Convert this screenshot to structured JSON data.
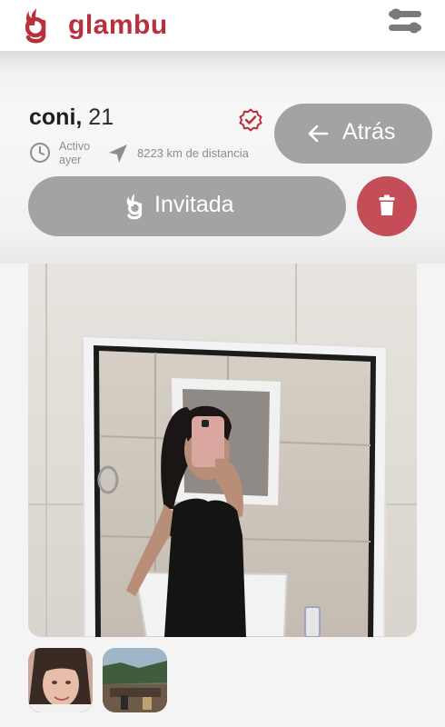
{
  "app": {
    "logo_text": "glambu",
    "brand_color": "#b9303d"
  },
  "profile": {
    "name": "coni,",
    "age": "21",
    "activity_line1": "Activo",
    "activity_line2": "ayer",
    "distance": "8223  km de distancia",
    "verified_icon": "verified-badge-icon"
  },
  "actions": {
    "back_label": "Atrás",
    "invite_label": "Invitada",
    "delete_icon": "trash-icon",
    "button_color": "#a3a3a3",
    "delete_color": "#c44d58"
  },
  "photos": {
    "main_photo": "mirror-selfie-photo",
    "thumbnails": [
      "portrait-thumbnail",
      "outdoor-thumbnail"
    ]
  }
}
